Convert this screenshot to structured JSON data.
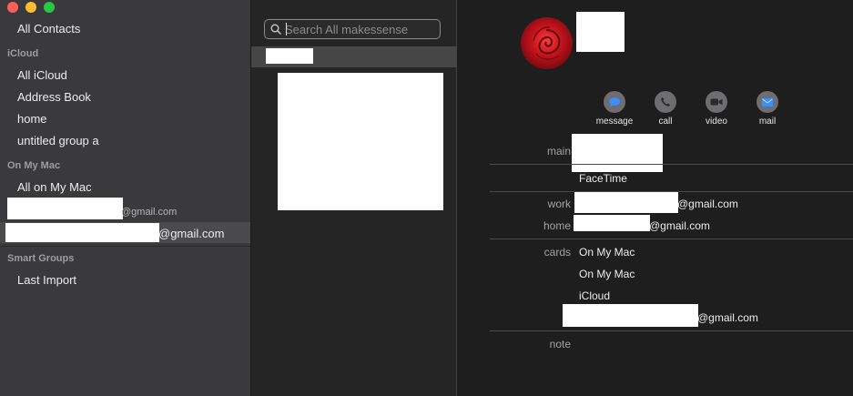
{
  "window_controls": [
    "close",
    "minimize",
    "zoom"
  ],
  "sidebar": {
    "all_contacts": "All Contacts",
    "sections": [
      {
        "header": "iCloud",
        "items": [
          "All iCloud",
          "Address Book",
          "home",
          "untitled group a"
        ]
      },
      {
        "header": "On My Mac",
        "items": [
          "All on My Mac"
        ]
      },
      {
        "header": "Smart Groups",
        "items": [
          "Last Import"
        ]
      }
    ],
    "accounts": [
      {
        "suffix": "@gmail.com"
      },
      {
        "suffix": "@gmail.com",
        "selected": true
      }
    ]
  },
  "list": {
    "search_placeholder": "Search All makessense"
  },
  "detail": {
    "actions": [
      {
        "label": "message",
        "icon": "message-icon",
        "color": "#3d8ef7"
      },
      {
        "label": "call",
        "icon": "phone-icon"
      },
      {
        "label": "video",
        "icon": "video-icon"
      },
      {
        "label": "mail",
        "icon": "mail-icon",
        "color": "#3d8ef7"
      }
    ],
    "fields": {
      "main_label": "main",
      "facetime_label": "FaceTime",
      "work_label": "work",
      "work_email_suffix": "@gmail.com",
      "home_label": "home",
      "home_email_suffix": "@gmail.com",
      "cards_label": "cards",
      "cards": [
        "On My Mac",
        "On My Mac",
        "iCloud"
      ],
      "card_email_suffix": "@gmail.com",
      "note_label": "note"
    }
  }
}
